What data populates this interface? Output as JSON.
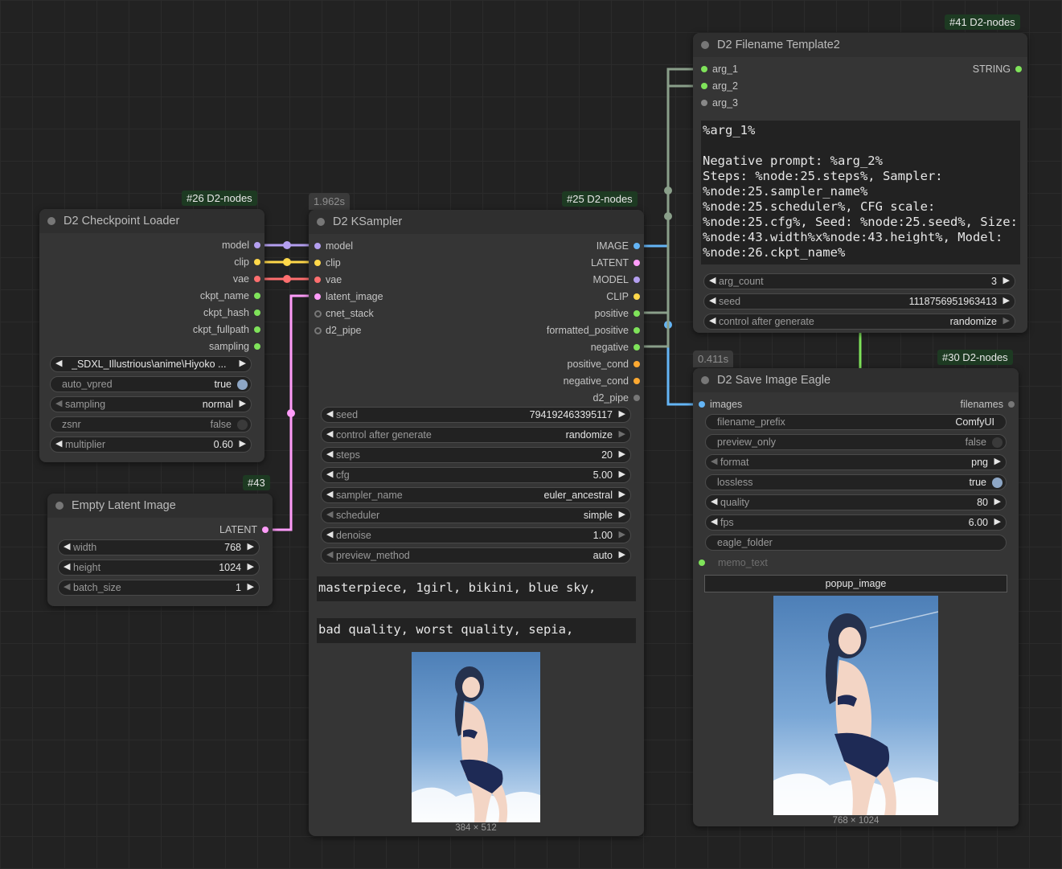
{
  "colors": {
    "model": "#b49ff0",
    "clip": "#ffd84a",
    "vae": "#ff6f6f",
    "latent": "#ff9cf9",
    "image": "#64b5f6",
    "conditioning": "#ffa931",
    "string": "#7fe35a",
    "pipe": "#777777",
    "badge_bg": "#1d3a22"
  },
  "node41": {
    "badge": "#41 D2-nodes",
    "title": "D2 Filename Template2",
    "inputs": [
      "arg_1",
      "arg_2",
      "arg_3"
    ],
    "output": "STRING",
    "template_text": "%arg_1%\n\nNegative prompt: %arg_2%\nSteps: %node:25.steps%, Sampler: %node:25.sampler_name% %node:25.scheduler%, CFG scale: %node:25.cfg%, Seed: %node:25.seed%, Size: %node:43.width%x%node:43.height%, Model: %node:26.ckpt_name%",
    "widgets": [
      {
        "label": "arg_count",
        "value": "3"
      },
      {
        "label": "seed",
        "value": "1118756951963413"
      },
      {
        "label": "control after generate",
        "value": "randomize"
      }
    ]
  },
  "node26": {
    "badge": "#26 D2-nodes",
    "title": "D2 Checkpoint Loader",
    "outputs": [
      "model",
      "clip",
      "vae",
      "ckpt_name",
      "ckpt_hash",
      "ckpt_fullpath",
      "sampling"
    ],
    "ckpt_value": "_SDXL_Illustrious\\anime\\Hiyoko ...",
    "widgets": [
      {
        "label": "auto_vpred",
        "value": "true"
      },
      {
        "label": "sampling",
        "value": "normal"
      },
      {
        "label": "zsnr",
        "value": "false"
      },
      {
        "label": "multiplier",
        "value": "0.60"
      }
    ]
  },
  "node25": {
    "badge": "#25 D2-nodes",
    "exec_time": "1.962s",
    "title": "D2 KSampler",
    "inputs": [
      "model",
      "clip",
      "vae",
      "latent_image",
      "cnet_stack",
      "d2_pipe"
    ],
    "outputs": [
      "IMAGE",
      "LATENT",
      "MODEL",
      "CLIP",
      "positive",
      "formatted_positive",
      "negative",
      "positive_cond",
      "negative_cond",
      "d2_pipe"
    ],
    "widgets": [
      {
        "label": "seed",
        "value": "794192463395117"
      },
      {
        "label": "control after generate",
        "value": "randomize"
      },
      {
        "label": "steps",
        "value": "20"
      },
      {
        "label": "cfg",
        "value": "5.00"
      },
      {
        "label": "sampler_name",
        "value": "euler_ancestral"
      },
      {
        "label": "scheduler",
        "value": "simple"
      },
      {
        "label": "denoise",
        "value": "1.00"
      },
      {
        "label": "preview_method",
        "value": "auto"
      }
    ],
    "positive_text": "masterpiece, 1girl, bikini, blue sky,",
    "negative_text": "bad quality, worst quality, sepia,",
    "preview_size": "384 × 512"
  },
  "node43": {
    "badge": "#43",
    "title": "Empty Latent Image",
    "output": "LATENT",
    "widgets": [
      {
        "label": "width",
        "value": "768"
      },
      {
        "label": "height",
        "value": "1024"
      },
      {
        "label": "batch_size",
        "value": "1"
      }
    ]
  },
  "node30": {
    "badge": "#30 D2-nodes",
    "exec_time": "0.411s",
    "title": "D2 Save Image Eagle",
    "input": "images",
    "output": "filenames",
    "widgets": [
      {
        "label": "filename_prefix",
        "value": "ComfyUI"
      },
      {
        "label": "preview_only",
        "value": "false"
      },
      {
        "label": "format",
        "value": "png"
      },
      {
        "label": "lossless",
        "value": "true"
      },
      {
        "label": "quality",
        "value": "80"
      },
      {
        "label": "fps",
        "value": "6.00"
      },
      {
        "label": "eagle_folder",
        "value": ""
      }
    ],
    "memo_label": "memo_text",
    "popup_label": "popup_image",
    "image_size": "768 × 1024"
  }
}
